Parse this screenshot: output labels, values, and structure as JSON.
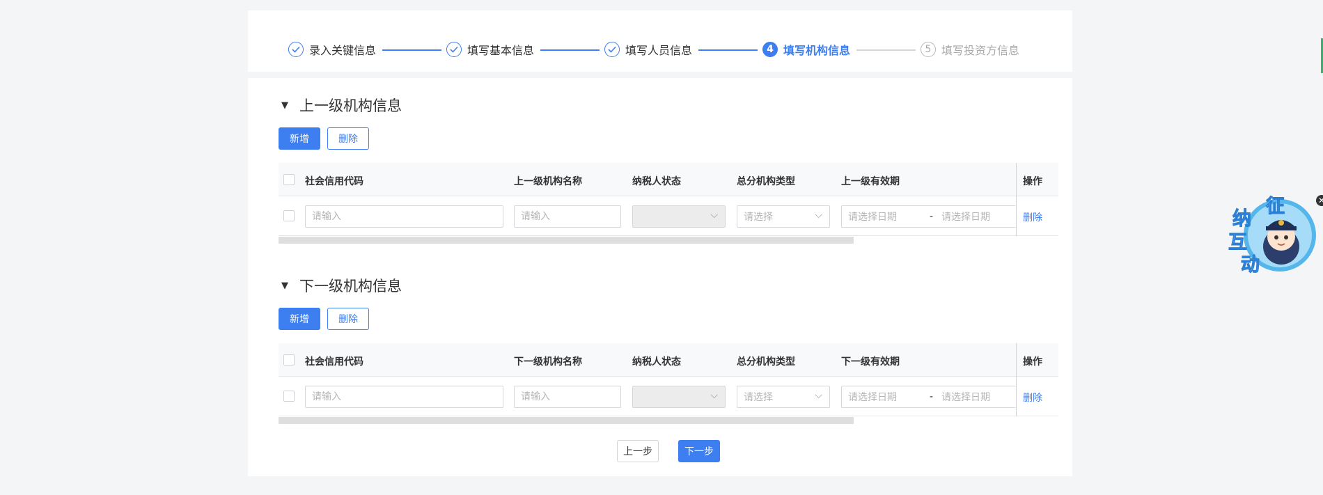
{
  "steps": [
    {
      "label": "录入关键信息",
      "state": "done"
    },
    {
      "label": "填写基本信息",
      "state": "done"
    },
    {
      "label": "填写人员信息",
      "state": "done"
    },
    {
      "label": "填写机构信息",
      "state": "active",
      "number": "4"
    },
    {
      "label": "填写投资方信息",
      "state": "pending",
      "number": "5"
    }
  ],
  "upper": {
    "title": "上一级机构信息",
    "add_label": "新增",
    "delete_label": "删除",
    "columns": [
      "社会信用代码",
      "上一级机构名称",
      "纳税人状态",
      "总分机构类型",
      "上一级有效期",
      "操作"
    ],
    "row": {
      "credit_code_placeholder": "请输入",
      "name_placeholder": "请输入",
      "status_value": "",
      "type_placeholder": "请选择",
      "date_start_placeholder": "请选择日期",
      "date_separator": "-",
      "date_end_placeholder": "请选择日期",
      "delete_link": "删除"
    }
  },
  "lower": {
    "title": "下一级机构信息",
    "add_label": "新增",
    "delete_label": "删除",
    "columns": [
      "社会信用代码",
      "下一级机构名称",
      "纳税人状态",
      "总分机构类型",
      "下一级有效期",
      "操作"
    ],
    "row": {
      "credit_code_placeholder": "请输入",
      "name_placeholder": "请输入",
      "status_value": "",
      "type_placeholder": "请选择",
      "date_start_placeholder": "请选择日期",
      "date_separator": "-",
      "date_end_placeholder": "请选择日期",
      "delete_link": "删除"
    }
  },
  "footer": {
    "prev_label": "上一步",
    "next_label": "下一步"
  },
  "assistant": {
    "chars": [
      "征",
      "纳",
      "互",
      "动"
    ]
  },
  "colors": {
    "primary": "#3d7ef0",
    "page_bg": "#f4f5f7",
    "disabled_bg": "#ececec"
  }
}
